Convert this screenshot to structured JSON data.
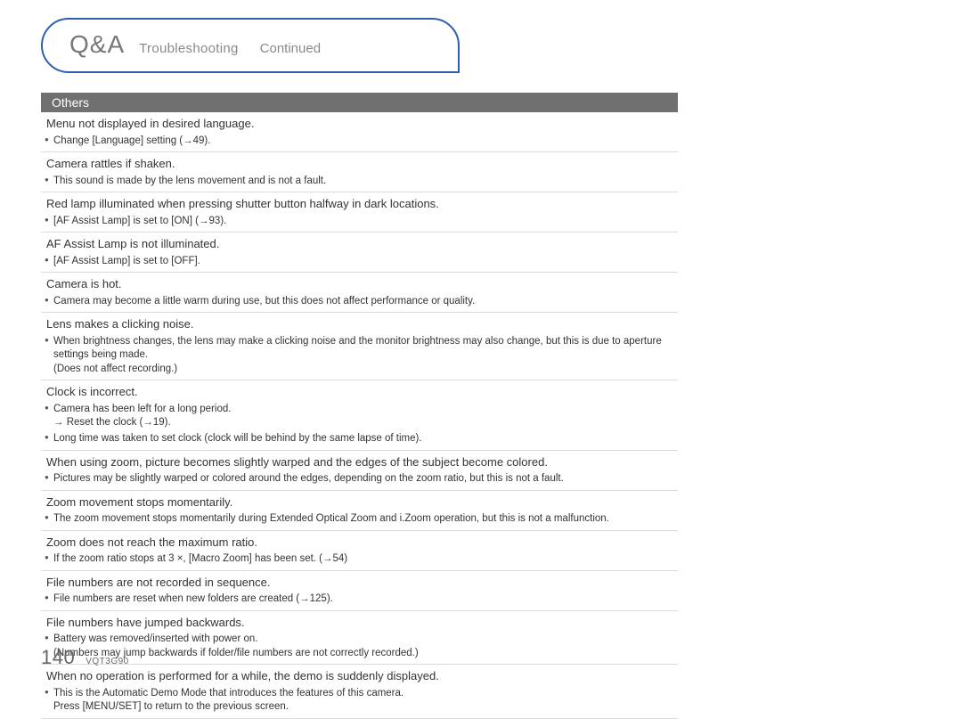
{
  "header": {
    "qa": "Q&A",
    "subtitle": "Troubleshooting",
    "continued": "Continued"
  },
  "section": "Others",
  "items": [
    {
      "q": "Menu not displayed in desired language.",
      "a": [
        "Change [Language] setting (→49)."
      ]
    },
    {
      "q": "Camera rattles if shaken.",
      "a": [
        "This sound is made by the lens movement and is not a fault."
      ]
    },
    {
      "q": "Red lamp illuminated when pressing shutter button halfway in dark locations.",
      "a": [
        "[AF Assist Lamp] is set to [ON] (→93)."
      ]
    },
    {
      "q": "AF Assist Lamp is not illuminated.",
      "a": [
        "[AF Assist Lamp] is set to [OFF]."
      ]
    },
    {
      "q": "Camera is hot.",
      "a": [
        "Camera may become a little warm during use, but this does not affect performance or quality."
      ]
    },
    {
      "q": "Lens makes a clicking noise.",
      "a": [
        "When brightness changes, the lens may make a clicking noise and the monitor brightness may also change, but this is due to aperture settings being made.\n(Does not affect recording.)"
      ]
    },
    {
      "q": "Clock is incorrect.",
      "a": [
        "Camera has been left for a long period.\n→ Reset the clock (→19).",
        "Long time was taken to set clock (clock will be behind by the same lapse of time)."
      ]
    },
    {
      "q": "When using zoom, picture becomes slightly warped and the edges of the subject become colored.",
      "a": [
        "Pictures may be slightly warped or colored around the edges, depending on the zoom ratio, but this is not a fault."
      ]
    },
    {
      "q": "Zoom movement stops momentarily.",
      "a": [
        "The zoom movement stops momentarily during Extended Optical Zoom and i.Zoom operation, but this is not a malfunction."
      ]
    },
    {
      "q": "Zoom does not reach the maximum ratio.",
      "a": [
        "If the zoom ratio stops at 3 ×, [Macro Zoom] has been set. (→54)"
      ]
    },
    {
      "q": "File numbers are not recorded in sequence.",
      "a": [
        "File numbers are reset when new folders are created (→125)."
      ]
    },
    {
      "q": "File numbers have jumped backwards.",
      "a": [
        "Battery was removed/inserted with power on.\n(Numbers may jump backwards if folder/file numbers are not correctly recorded.)"
      ]
    },
    {
      "q": "When no operation is performed for a while, the demo is suddenly displayed.",
      "a": [
        "This is the Automatic Demo Mode that introduces the features of this camera.\nPress [MENU/SET] to return to the previous screen."
      ]
    }
  ],
  "footer": {
    "page": "140",
    "docid": "VQT3G90"
  }
}
